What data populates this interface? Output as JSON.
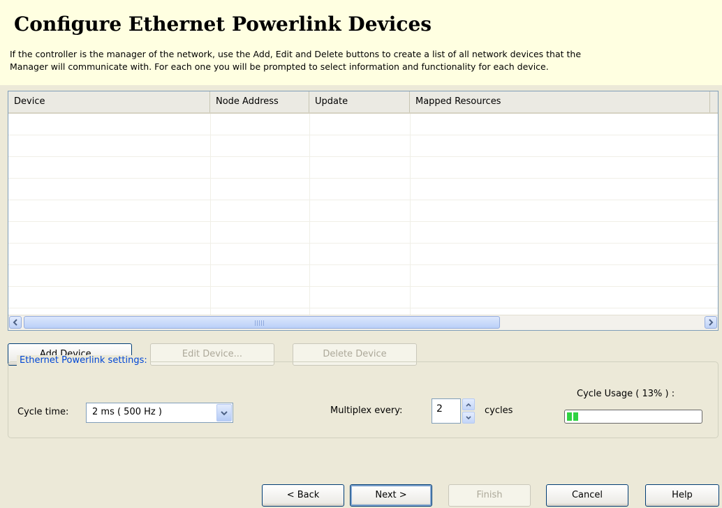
{
  "header": {
    "title": "Configure Ethernet Powerlink Devices",
    "description_line1": "If the controller is the manager of the network, use the Add, Edit and Delete buttons to create a list of all network devices that the",
    "description_line2": "Manager will communicate with. For each one you will be prompted to select information and functionality for each device."
  },
  "table": {
    "columns": [
      "Device",
      "Node Address",
      "Update",
      "Mapped Resources"
    ],
    "rows": []
  },
  "device_buttons": {
    "add": "Add Device...",
    "edit": "Edit Device...",
    "delete": "Delete Device"
  },
  "settings": {
    "group_label": "Ethernet Powerlink settings:",
    "cycle_time_label": "Cycle time:",
    "cycle_time_value": "2 ms ( 500 Hz )",
    "multiplex_label": "Multiplex every:",
    "multiplex_value": "2",
    "multiplex_unit": "cycles",
    "cycle_usage_label": "Cycle Usage ( 13% ) :",
    "cycle_usage_percent": 13
  },
  "wizard_buttons": {
    "back": "< Back",
    "next": "Next >",
    "finish": "Finish",
    "cancel": "Cancel",
    "help": "Help"
  },
  "colors": {
    "header_bg": "#FFFFE1",
    "dialog_bg": "#ECE9D8",
    "group_label": "#0046D5",
    "progress_fill": "#2FD242"
  },
  "icons": {
    "scroll_left": "arrow-left-icon",
    "scroll_right": "arrow-right-icon",
    "combo_dropdown": "chevron-down-icon",
    "spin_up": "spin-up-icon",
    "spin_down": "spin-down-icon"
  }
}
